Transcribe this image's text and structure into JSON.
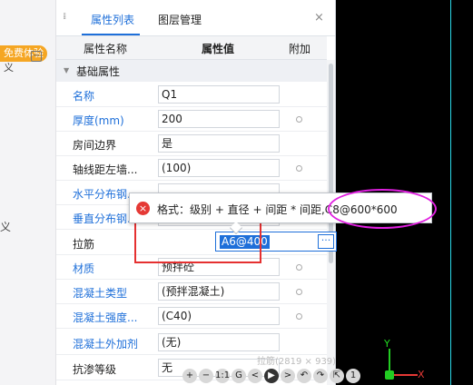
{
  "left_strip": {
    "badge": "免费体验",
    "side_char_top": "义",
    "side_char_mid": "义"
  },
  "panel": {
    "tabs": [
      "属性列表",
      "图层管理"
    ],
    "close": "×",
    "header": {
      "name": "属性名称",
      "value": "属性值",
      "extra": "附加"
    },
    "section": {
      "arrow": "▼",
      "label": "基础属性"
    },
    "rows": [
      {
        "name": "名称",
        "value": "Q1"
      },
      {
        "name": "厚度(mm)",
        "value": "200"
      },
      {
        "name": "房间边界",
        "value": "是"
      },
      {
        "name": "轴线距左墙...",
        "value": "(100)"
      },
      {
        "name": "水平分布钢...",
        "value": ""
      },
      {
        "name": "垂直分布钢...",
        "value": ""
      },
      {
        "name": "拉筋",
        "value": "A6@400"
      },
      {
        "name": "材质",
        "value": "预拌砼"
      },
      {
        "name": "混凝土类型",
        "value": "(预拌混凝土)"
      },
      {
        "name": "混凝土强度...",
        "value": "(C40)"
      },
      {
        "name": "混凝土外加剂",
        "value": "(无)"
      },
      {
        "name": "抗渗等级",
        "value": "无"
      }
    ],
    "more_btn": "···"
  },
  "tooltip": {
    "icon": "×",
    "message": "格式：级别 + 直径 + 间距 * 间距,C8@600*600"
  },
  "viewport": {
    "hint": "拉筋(2819 × 939)",
    "axis_y": "Y",
    "axis_x": "X",
    "toolbar": [
      "+",
      "−",
      "1:1",
      "G",
      "<",
      "▶",
      ">",
      "↶",
      "↷",
      "⇱",
      "1"
    ]
  },
  "colors": {
    "accent": "#1e6fd9",
    "error": "#e53935",
    "annotation_red": "#e53030",
    "annotation_magenta": "#e020e0"
  }
}
